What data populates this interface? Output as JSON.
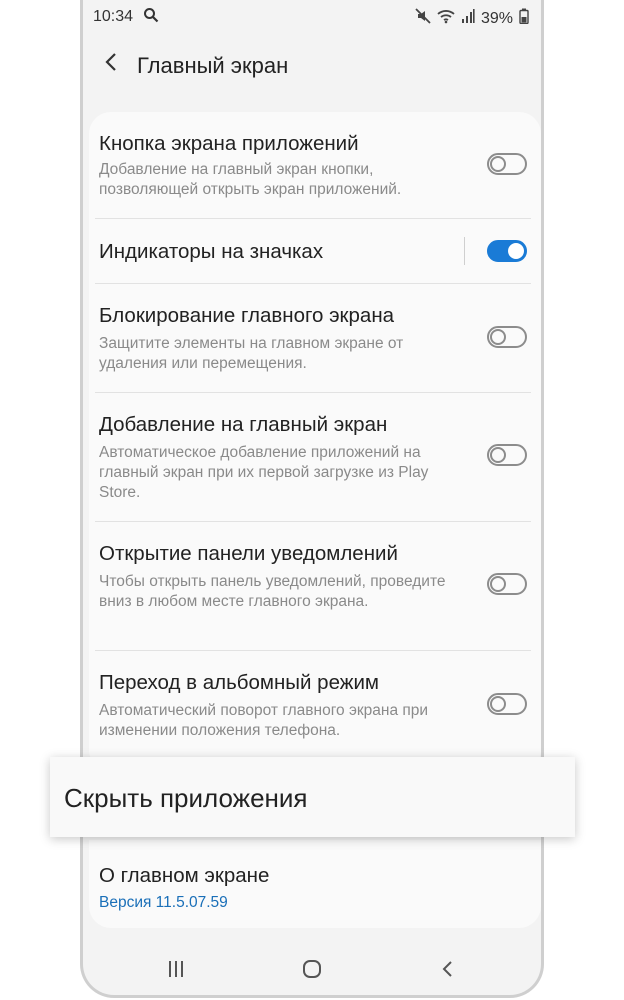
{
  "status_bar": {
    "time": "10:34",
    "battery": "39%",
    "icons": [
      "search-icon",
      "mute-icon",
      "wifi-icon",
      "signal-icon",
      "battery-icon"
    ]
  },
  "header": {
    "back_icon": "chevron-left-icon",
    "title": "Главный экран"
  },
  "settings": [
    {
      "title": "Кнопка экрана приложений",
      "desc": "Добавление на главный экран кнопки, позволяющей открыть экран приложений.",
      "enabled": false
    },
    {
      "title": "Индикаторы на значках",
      "desc": "",
      "enabled": true
    },
    {
      "title": "Блокирование главного экрана",
      "desc": "Защитите элементы на главном экране от удаления или перемещения.",
      "enabled": false
    },
    {
      "title": "Добавление на главный экран",
      "desc": "Автоматическое добавление приложений на главный экран при их первой загрузке из Play Store.",
      "enabled": false
    },
    {
      "title": "Открытие панели уведомлений",
      "desc": "Чтобы открыть панель уведомлений, проведите вниз в любом месте главного экрана.",
      "enabled": false
    },
    {
      "title": "Переход в альбомный режим",
      "desc": "Автоматический поворот главного экрана при изменении положения телефона.",
      "enabled": false
    }
  ],
  "highlight": {
    "title": "Скрыть приложения"
  },
  "about": {
    "title": "О главном экране",
    "version": "Версия 11.5.07.59"
  },
  "nav_bar": {
    "icons": [
      "recent-apps-icon",
      "home-icon",
      "back-icon"
    ]
  },
  "colors": {
    "accent": "#1a7bd6",
    "version_text": "#1a6fb8",
    "background": "#f3f3f3"
  }
}
